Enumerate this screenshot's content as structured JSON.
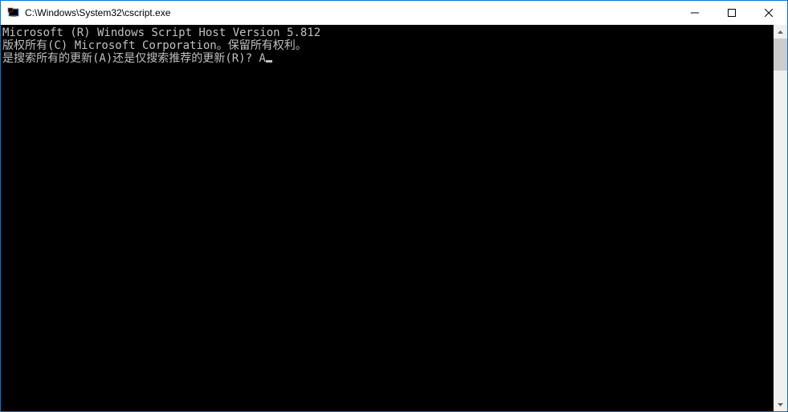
{
  "window": {
    "title": "C:\\Windows\\System32\\cscript.exe"
  },
  "console": {
    "lines": [
      "Microsoft (R) Windows Script Host Version 5.812",
      "版权所有(C) Microsoft Corporation。保留所有权利。",
      "",
      "是搜索所有的更新(A)还是仅搜索推荐的更新(R)? A"
    ]
  }
}
